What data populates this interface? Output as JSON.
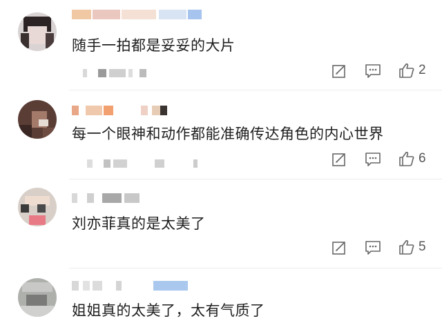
{
  "comments": [
    {
      "text": "随手一拍都是妥妥的大片",
      "likes": "2"
    },
    {
      "text": "每一个眼神和动作都能准确传达角色的内心世界",
      "likes": "6"
    },
    {
      "text": "刘亦菲真的是太美了",
      "likes": "5"
    },
    {
      "text": "姐姐真的太美了，太有气质了",
      "likes": ""
    }
  ],
  "icons": {
    "edit": "edit-icon",
    "reply": "comment-icon",
    "like": "thumbs-up-icon"
  },
  "colors": {
    "icon": "#666666",
    "text": "#1e1e1e",
    "blur_blue": "#aac8ee"
  }
}
